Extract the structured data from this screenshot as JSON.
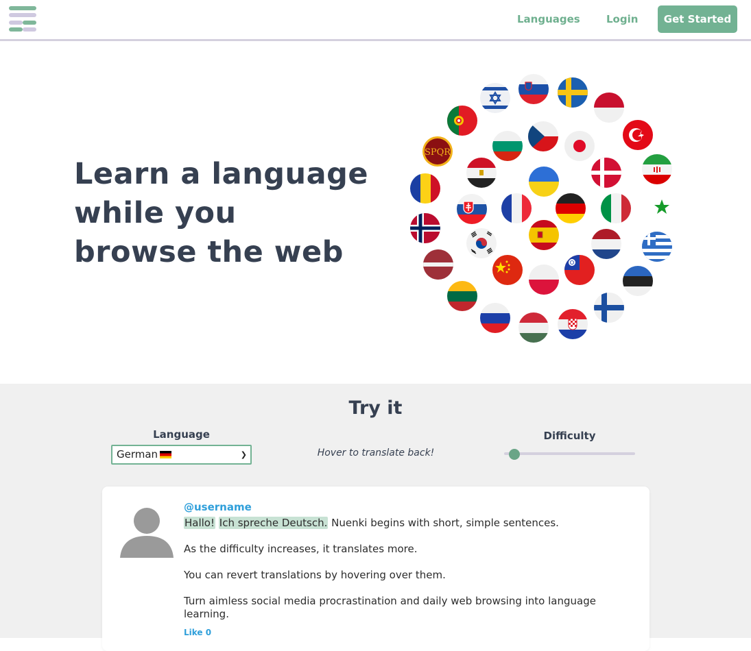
{
  "nav": {
    "logo_icon": "nuenki-logo-icon",
    "links": [
      "Languages",
      "Login"
    ],
    "cta": "Get Started",
    "accent": "#72b293"
  },
  "hero": {
    "title_lines": [
      "Learn a language",
      "while you",
      "browse the web"
    ]
  },
  "flags": [
    "israel",
    "slovenia",
    "sweden",
    "indonesia",
    "portugal",
    "turkey",
    "latin-spqr",
    "bulgaria",
    "czech",
    "japan",
    "iran",
    "egypt",
    "denmark",
    "romania",
    "ukraine",
    "esperanto",
    "slovakia",
    "france",
    "germany",
    "italy",
    "norway",
    "korea",
    "spain",
    "netherlands",
    "greece",
    "latvia",
    "china",
    "taiwan",
    "poland",
    "estonia",
    "lithuania",
    "finland",
    "russia",
    "hungary",
    "croatia"
  ],
  "flags_spqr_text": "SPQR",
  "try_it": {
    "title": "Try it",
    "language_label": "Language",
    "language_value": "German",
    "hover_note": "Hover to translate back!",
    "difficulty_label": "Difficulty",
    "difficulty_level": 0.08
  },
  "post": {
    "username": "@username",
    "translated_1": "Hallo!",
    "translated_2": "Ich spreche Deutsch.",
    "line1_rest": " Nuenki begins with short, simple sentences.",
    "line2": "As the difficulty increases, it translates more.",
    "line3": "You can revert translations by hovering over them.",
    "line4": "Turn aimless social media procrastination and daily web browsing into language learning.",
    "like": "Like 0"
  }
}
